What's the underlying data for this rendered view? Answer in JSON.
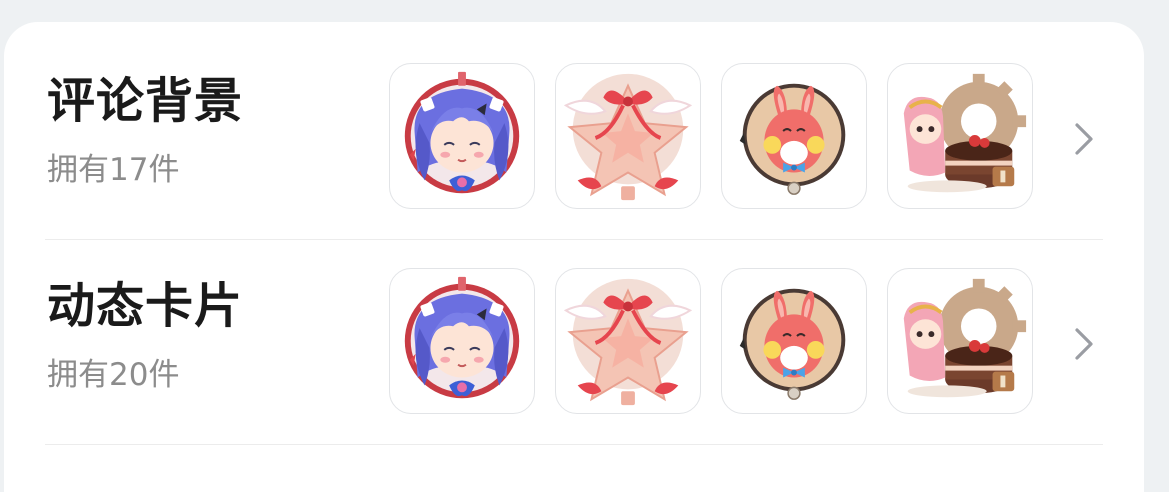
{
  "rows": [
    {
      "title": "评论背景",
      "count_text": "拥有17件",
      "items": [
        {
          "icon": "anime-girl-avatar-icon"
        },
        {
          "icon": "ribbon-star-icon"
        },
        {
          "icon": "rabbit-badge-icon"
        },
        {
          "icon": "gear-cake-girl-icon"
        }
      ]
    },
    {
      "title": "动态卡片",
      "count_text": "拥有20件",
      "items": [
        {
          "icon": "anime-girl-avatar-icon"
        },
        {
          "icon": "ribbon-star-icon"
        },
        {
          "icon": "rabbit-badge-icon"
        },
        {
          "icon": "gear-cake-girl-icon"
        }
      ]
    }
  ],
  "colors": {
    "title": "#1a1a1a",
    "subtitle": "#8c8c8c",
    "chevron": "#9a9da3",
    "accent_red": "#d94b4b",
    "accent_blue": "#5b72d6"
  }
}
